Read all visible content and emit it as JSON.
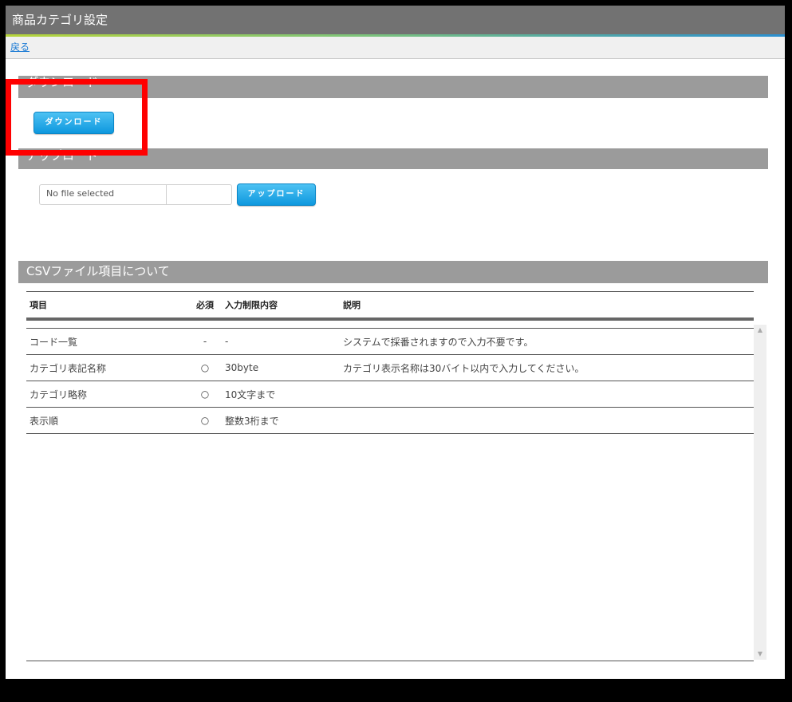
{
  "window": {
    "title": "商品カテゴリ設定"
  },
  "nav": {
    "back_label": "戻る"
  },
  "download": {
    "header": "ダウンロード",
    "button_label": "ダウンロード"
  },
  "upload": {
    "header": "アップロード",
    "file_status": "No file selected",
    "button_label": "アップロード"
  },
  "csv": {
    "header": "CSVファイル項目について",
    "columns": [
      "項目",
      "必須",
      "入力制限内容",
      "説明"
    ],
    "rows": [
      [
        "コード一覧",
        "-",
        "-",
        "システムで採番されますので入力不要です。"
      ],
      [
        "カテゴリ表記名称",
        "○",
        "30byte",
        "カテゴリ表示名称は30バイト以内で入力してください。"
      ],
      [
        "カテゴリ略称",
        "○",
        "10文字まで",
        ""
      ],
      [
        "表示順",
        "○",
        "整数3桁まで",
        ""
      ]
    ]
  },
  "colors": {
    "accent": "#0e98de",
    "highlight": "#ff0000",
    "header_bg": "#9b9b9b",
    "title_bg": "#727272"
  },
  "icons": {
    "scroll_up": "triangle-up-icon",
    "scroll_down": "triangle-down-icon"
  }
}
